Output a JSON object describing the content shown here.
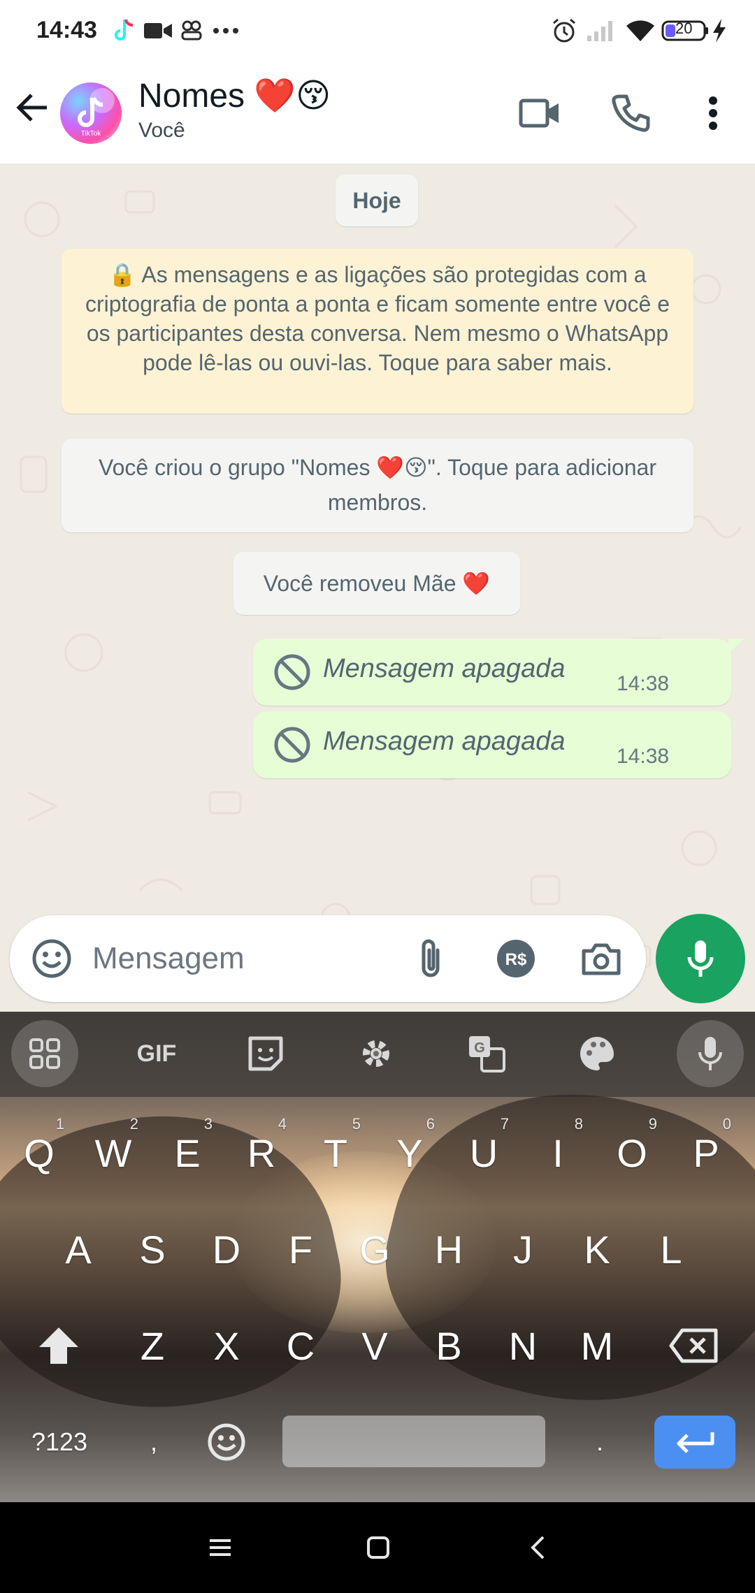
{
  "status_bar": {
    "time": "14:43",
    "battery": "20",
    "icons": [
      "tiktok-icon",
      "video-record-icon",
      "people-icon",
      "more-dots-icon",
      "alarm-icon",
      "signal-icon",
      "wifi-icon",
      "battery-icon",
      "charging-icon"
    ]
  },
  "header": {
    "title": "Nomes ❤️😚",
    "subtitle": "Você",
    "avatar_label": "TikTok"
  },
  "chat": {
    "date_label": "Hoje",
    "encryption_notice": "🔒 As mensagens e as ligações são protegidas com a criptografia de ponta a ponta e ficam somente entre você e os participantes desta conversa. Nem mesmo o WhatsApp pode lê-las ou ouvi-las. Toque para saber mais.",
    "system_created": "Você criou o grupo \"Nomes ❤️😚\". Toque para adicionar membros.",
    "system_removed": "Você removeu Mãe ❤️",
    "messages": [
      {
        "text": "Mensagem apagada",
        "time": "14:38"
      },
      {
        "text": "Mensagem apagada",
        "time": "14:38"
      }
    ]
  },
  "composer": {
    "placeholder": "Mensagem",
    "payment_label": "R$"
  },
  "keyboard": {
    "toolbar": {
      "gif": "GIF"
    },
    "row1": [
      {
        "k": "Q",
        "n": "1"
      },
      {
        "k": "W",
        "n": "2"
      },
      {
        "k": "E",
        "n": "3"
      },
      {
        "k": "R",
        "n": "4"
      },
      {
        "k": "T",
        "n": "5"
      },
      {
        "k": "Y",
        "n": "6"
      },
      {
        "k": "U",
        "n": "7"
      },
      {
        "k": "I",
        "n": "8"
      },
      {
        "k": "O",
        "n": "9"
      },
      {
        "k": "P",
        "n": "0"
      }
    ],
    "row2": [
      "A",
      "S",
      "D",
      "F",
      "G",
      "H",
      "J",
      "K",
      "L"
    ],
    "row3": [
      "Z",
      "X",
      "C",
      "V",
      "B",
      "N",
      "M"
    ],
    "symbols_label": "?123",
    "comma": ",",
    "period": "."
  },
  "colors": {
    "chat_bg": "#efeae2",
    "outgoing_bubble": "#e6fdd6",
    "encryption_bubble": "#fdf3d4",
    "mic_green": "#1aa260",
    "enter_blue": "#4b8ff3"
  }
}
